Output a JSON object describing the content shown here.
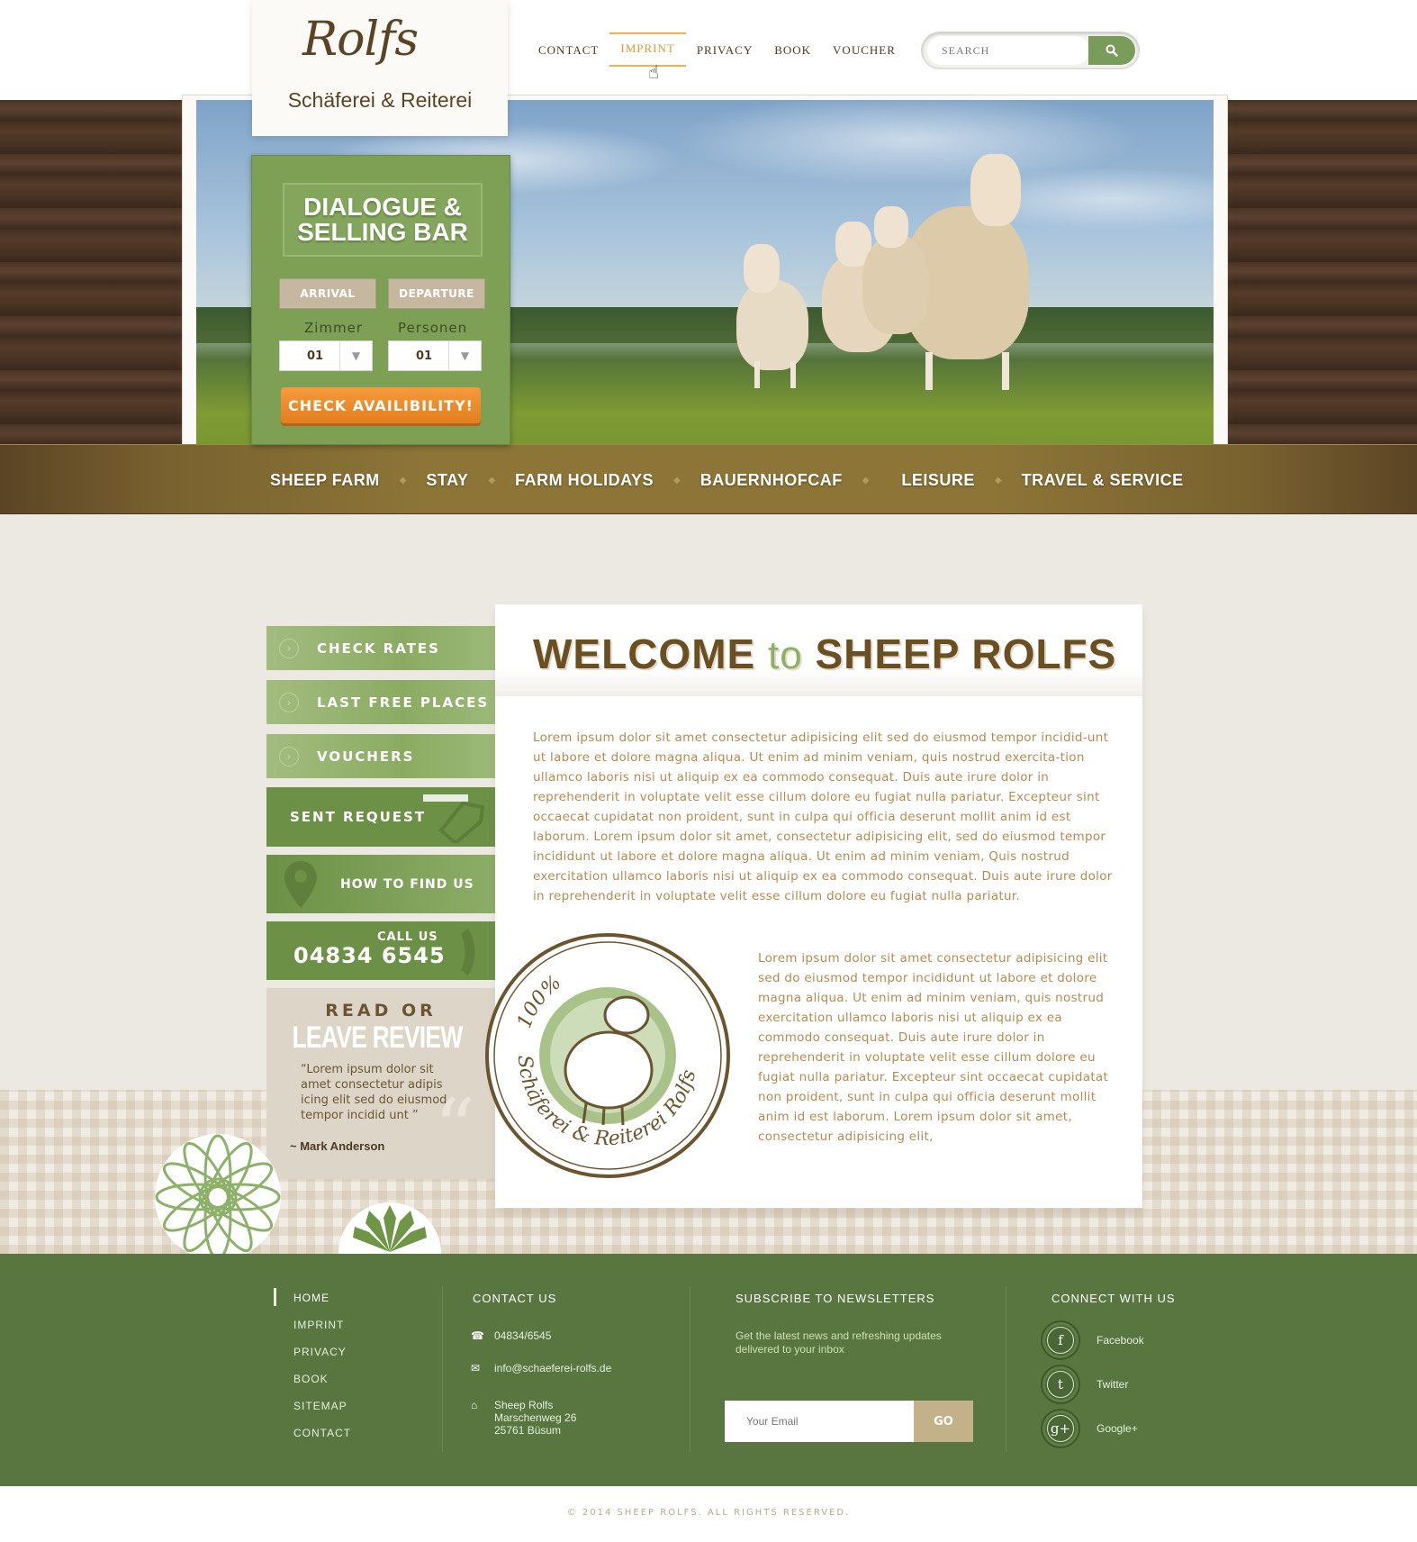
{
  "logo": {
    "script": "Rolfs",
    "subtitle": "Schäferei & Reiterei"
  },
  "topnav": [
    {
      "label": "CONTACT"
    },
    {
      "label": "IMPRINT",
      "active": true
    },
    {
      "label": "PRIVACY"
    },
    {
      "label": "BOOK"
    },
    {
      "label": "VOUCHER"
    }
  ],
  "search": {
    "placeholder": "SEARCH",
    "icon": "search-icon"
  },
  "booking": {
    "title": "DIALOGUE &\nSELLING BAR",
    "arrival": "ARRIVAL",
    "departure": "DEPARTURE",
    "zimmer_label": "Zimmer",
    "personen_label": "Personen",
    "zimmer_value": "01",
    "personen_value": "01",
    "check_button": "CHECK AVAILIBILITY!"
  },
  "mainnav": [
    {
      "label": "SHEEP FARM"
    },
    {
      "label": "STAY"
    },
    {
      "label": "FARM HOLIDAYS"
    },
    {
      "label": "BAUERNHOFCAF"
    },
    {
      "label": "LEISURE"
    },
    {
      "label": "TRAVEL & SERVICE"
    }
  ],
  "sidebar": {
    "check_rates": "CHECK RATES",
    "last_free": "LAST FREE PLACES",
    "vouchers": "VOUCHERS",
    "sent_request": "SENT REQUEST",
    "how_to_find": "HOW TO FIND US",
    "call_us_label": "CALL US",
    "phone": "04834 6545"
  },
  "review": {
    "line1": "READ OR",
    "line2": "LEAVE REVIEW",
    "quote": "“Lorem ipsum dolor sit amet consectetur adipis icing elit sed do eiusmod tempor incidid unt ”",
    "author": "~ Mark Anderson"
  },
  "welcome": {
    "title_a": "WELCOME",
    "title_to": "to",
    "title_b": "SHEEP ROLFS",
    "para1": "Lorem ipsum dolor sit amet consectetur adipisicing elit sed do eiusmod tempor incidid-unt ut labore et dolore magna aliqua. Ut enim ad minim veniam, quis nostrud exercita-tion ullamco laboris nisi ut aliquip ex ea commodo consequat. Duis aute irure dolor in reprehenderit in voluptate velit esse cillum dolore eu fugiat nulla pariatur. Excepteur sint occaecat cupidatat non proident, sunt in culpa qui officia deserunt mollit anim id est laborum. Lorem ipsum dolor sit amet, consectetur adipisicing elit, sed do eiusmod tempor incididunt ut labore et dolore magna aliqua. Ut enim ad minim veniam, Quis nostrud exercitation ullamco laboris nisi ut aliquip ex ea commodo consequat. Duis aute irure dolor in reprehenderit in voluptate velit esse cillum dolore eu fugiat nulla pariatur.",
    "para2": "Lorem ipsum dolor sit amet consectetur adipisicing elit sed do eiusmod tempor incididunt ut labore et dolore magna aliqua. Ut enim ad minim veniam, quis nostrud exercitation ullamco laboris nisi ut aliquip ex ea commodo consequat. Duis aute irure dolor in reprehenderit in voluptate velit esse cillum dolore eu fugiat nulla pariatur. Excepteur sint occaecat cupidatat non proident, sunt in culpa qui officia deserunt mollit anim id est laborum. Lorem ipsum dolor sit amet, consectetur adipisicing elit,",
    "stamp_percent": "100%",
    "stamp_text": "Schäferei & Reiterei Rolfs"
  },
  "footer": {
    "nav": [
      "HOME",
      "IMPRINT",
      "PRIVACY",
      "BOOK",
      "SITEMAP",
      "CONTACT"
    ],
    "contact_heading": "CONTACT US",
    "phone": "04834/6545",
    "email": "info@schaeferei-rolfs.de",
    "address_name": "Sheep Rolfs",
    "address_street": "Marschenweg 26",
    "address_city": "25761 Büsum",
    "newsletter_heading": "SUBSCRIBE TO NEWSLETTERS",
    "newsletter_text": "Get the latest news and refreshing updates delivered to your inbox",
    "email_placeholder": "Your Email",
    "go": "GO",
    "connect_heading": "CONNECT WITH US",
    "social": [
      {
        "name": "Facebook",
        "icon": "facebook-icon",
        "glyph": "f"
      },
      {
        "name": "Twitter",
        "icon": "twitter-icon",
        "glyph": "t"
      },
      {
        "name": "Google+",
        "icon": "googleplus-icon",
        "glyph": "g+"
      }
    ]
  },
  "copyright": "© 2014 SHEEP ROLFS. ALL RIGHTS RESERVED.",
  "colors": {
    "green": "#7da055",
    "brown": "#6a4f22",
    "orange": "#e37e1d",
    "footer": "#597640"
  }
}
